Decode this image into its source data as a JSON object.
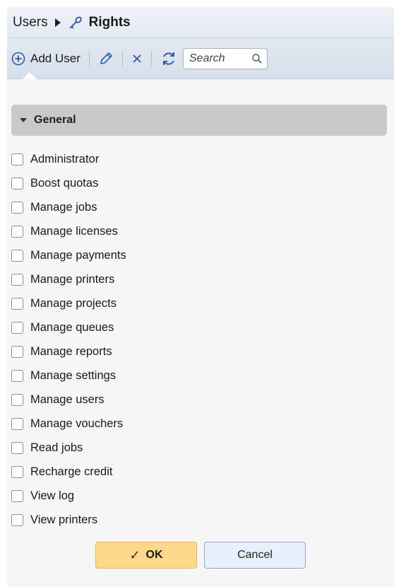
{
  "breadcrumb": {
    "parent": "Users",
    "current": "Rights"
  },
  "toolbar": {
    "add_user_label": "Add User",
    "edit_icon": "pencil-icon",
    "delete_icon": "close-icon",
    "refresh_icon": "refresh-icon",
    "search_placeholder": "Search"
  },
  "group": {
    "title": "General"
  },
  "rights": [
    {
      "label": "Administrator",
      "checked": false
    },
    {
      "label": "Boost quotas",
      "checked": false
    },
    {
      "label": "Manage jobs",
      "checked": false
    },
    {
      "label": "Manage licenses",
      "checked": false
    },
    {
      "label": "Manage payments",
      "checked": false
    },
    {
      "label": "Manage printers",
      "checked": false
    },
    {
      "label": "Manage projects",
      "checked": false
    },
    {
      "label": "Manage queues",
      "checked": false
    },
    {
      "label": "Manage reports",
      "checked": false
    },
    {
      "label": "Manage settings",
      "checked": false
    },
    {
      "label": "Manage users",
      "checked": false
    },
    {
      "label": "Manage vouchers",
      "checked": false
    },
    {
      "label": "Read jobs",
      "checked": false
    },
    {
      "label": "Recharge credit",
      "checked": false
    },
    {
      "label": "View log",
      "checked": false
    },
    {
      "label": "View printers",
      "checked": false
    }
  ],
  "buttons": {
    "ok": "OK",
    "cancel": "Cancel"
  },
  "colors": {
    "ok_bg": "#fcd98a",
    "cancel_bg": "#e9f0fb",
    "group_bg": "#c9c9c9",
    "accent": "#2b5aa8"
  }
}
